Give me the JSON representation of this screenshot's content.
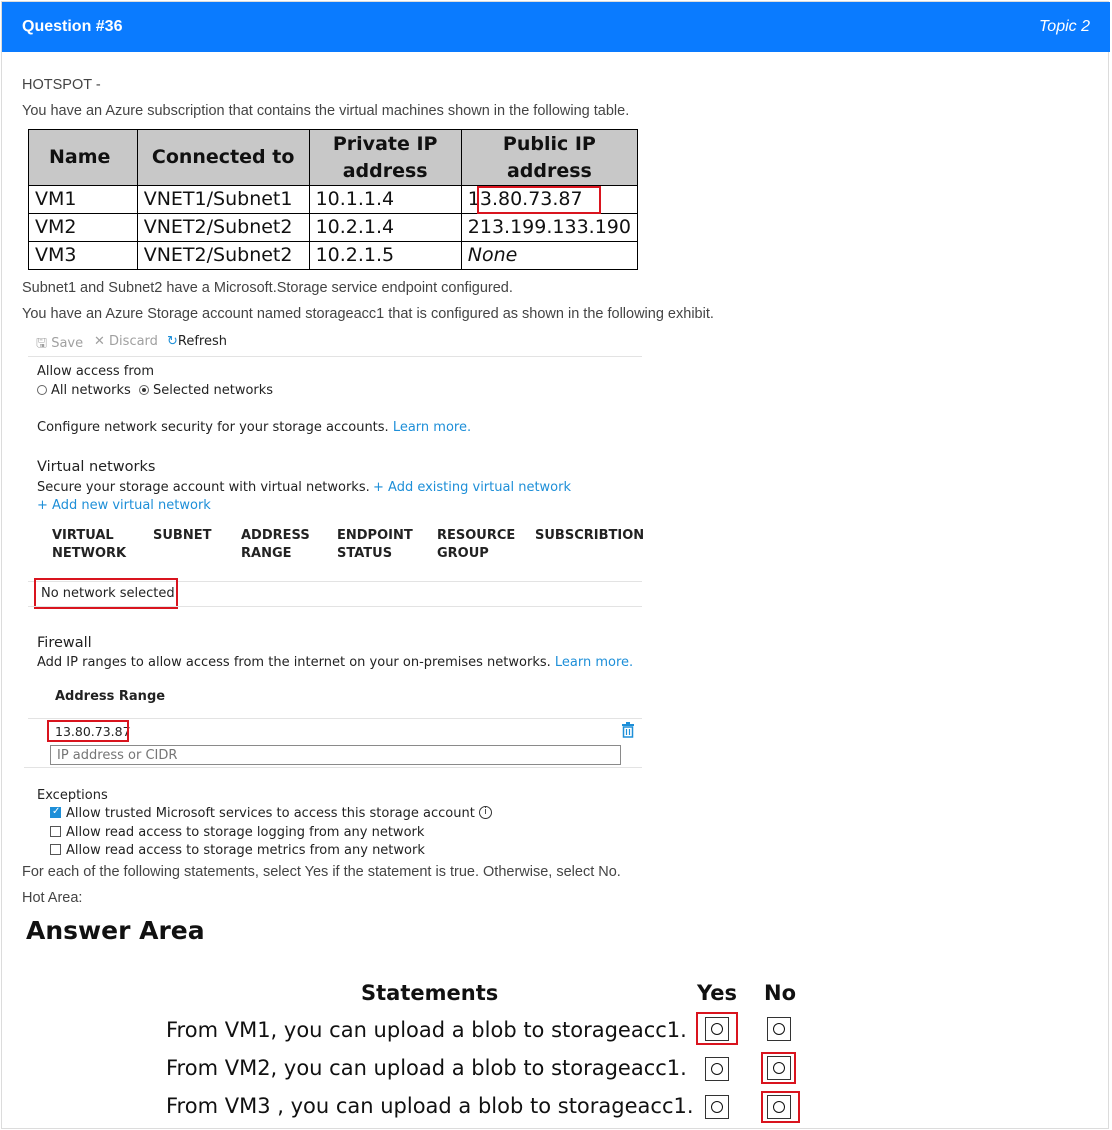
{
  "header": {
    "question": "Question #36",
    "topic": "Topic 2"
  },
  "intro": {
    "hotspot": "HOTSPOT -",
    "line1": "You have an Azure subscription that contains the virtual machines shown in the following table.",
    "line2": "Subnet1 and Subnet2 have a Microsoft.Storage service endpoint configured.",
    "line3": "You have an Azure Storage account named storageacc1 that is configured as shown in the following exhibit.",
    "line4": "For each of the following statements, select Yes if the statement is true. Otherwise, select No.",
    "hot_area": "Hot Area:"
  },
  "vm_table": {
    "headers": [
      "Name",
      "Connected to",
      "Private IP address",
      "Public IP address"
    ],
    "rows": [
      [
        "VM1",
        "VNET1/Subnet1",
        "10.1.1.4",
        "13.80.73.87"
      ],
      [
        "VM2",
        "VNET2/Subnet2",
        "10.2.1.4",
        "213.199.133.190"
      ],
      [
        "VM3",
        "VNET2/Subnet2",
        "10.2.1.5",
        "None"
      ]
    ]
  },
  "exhibit": {
    "toolbar": {
      "save": "Save",
      "discard": "Discard",
      "refresh": "Refresh"
    },
    "allow_access_label": "Allow access from",
    "radio_all": "All networks",
    "radio_selected": "Selected networks",
    "configure_text": "Configure network security for your storage accounts.",
    "learn_more": "Learn more.",
    "vnet_title": "Virtual networks",
    "vnet_desc": "Secure your storage account with virtual networks.",
    "add_existing": "+ Add existing virtual network",
    "add_new": "+ Add new virtual network",
    "columns": {
      "c1a": "VIRTUAL",
      "c1b": "NETWORK",
      "c2": "SUBNET",
      "c3a": "ADDRESS",
      "c3b": "RANGE",
      "c4a": "ENDPOINT",
      "c4b": "STATUS",
      "c5a": "RESOURCE",
      "c5b": "GROUP",
      "c6": "SUBSCRIBTION"
    },
    "no_network": "No network selected.",
    "firewall_title": "Firewall",
    "firewall_desc": "Add IP ranges to allow access from the internet on your on-premises networks.",
    "firewall_learn": "Learn more.",
    "address_range_label": "Address Range",
    "address_value": "13.80.73.87",
    "ip_placeholder": "IP address or CIDR",
    "exceptions_title": "Exceptions",
    "exceptions": [
      {
        "label": "Allow trusted Microsoft services to access this storage account",
        "checked": true
      },
      {
        "label": "Allow read access to storage logging from any network",
        "checked": false
      },
      {
        "label": "Allow read access to storage metrics from any network",
        "checked": false
      }
    ],
    "selected_radio": "Selected networks"
  },
  "answer": {
    "title": "Answer Area",
    "col_statements": "Statements",
    "col_yes": "Yes",
    "col_no": "No",
    "statements": [
      {
        "text": "From VM1, you can upload a blob to storageacc1.",
        "selected": "Yes"
      },
      {
        "text": "From VM2, you can upload a blob to storageacc1.",
        "selected": "No"
      },
      {
        "text": "From VM3 , you can upload a blob to storageacc1.",
        "selected": "No"
      }
    ]
  },
  "colors": {
    "header_bg": "#0a7bff",
    "highlight": "#d9141e",
    "link": "#1e8fd8",
    "table_head_bg": "#c8c8c8"
  }
}
